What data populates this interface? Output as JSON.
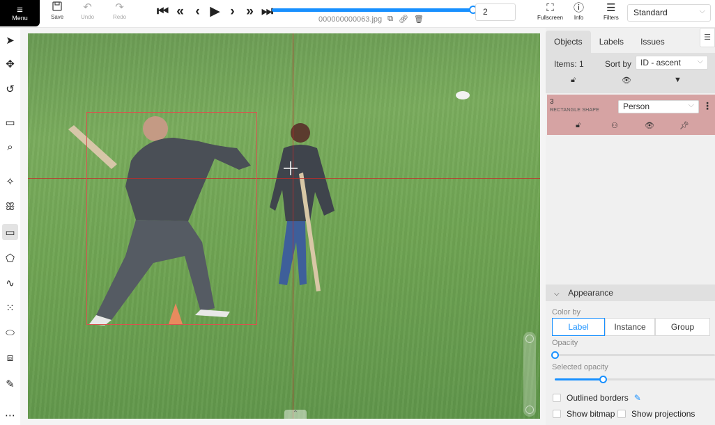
{
  "toolbar": {
    "menu_label": "Menu",
    "save_label": "Save",
    "undo_label": "Undo",
    "redo_label": "Redo",
    "frame_number": "2",
    "filename": "000000000063.jpg",
    "fullscreen_label": "Fullscreen",
    "info_label": "Info",
    "filters_label": "Filters",
    "workspace": "Standard"
  },
  "navigation": {
    "icons": [
      "first-frame-icon",
      "fast-backward-icon",
      "prev-frame-icon",
      "play-icon",
      "next-frame-icon",
      "fast-forward-icon",
      "last-frame-icon"
    ],
    "frame_slider_progress": 0.98
  },
  "left_tools": [
    "cursor-icon",
    "move-icon",
    "rotate-icon",
    "fit-image-icon",
    "zoom-region-icon",
    "magic-wand-icon",
    "opencv-icon",
    "rectangle-icon",
    "polygon-icon",
    "polyline-icon",
    "points-icon",
    "ellipse-icon",
    "cuboid-icon",
    "brush-icon",
    "more-icon"
  ],
  "side_panel": {
    "tabs": [
      "Objects",
      "Labels",
      "Issues"
    ],
    "active_tab": "Objects",
    "items_label": "Items: 1",
    "sort_label": "Sort by",
    "sort_value": "ID - ascent",
    "objects": [
      {
        "id": "3",
        "type": "RECTANGLE SHAPE",
        "label": "Person",
        "color": "#d6a3a3"
      }
    ]
  },
  "appearance": {
    "title": "Appearance",
    "color_by_label": "Color by",
    "color_by_options": [
      "Label",
      "Instance",
      "Group"
    ],
    "color_by_selected": "Label",
    "opacity_label": "Opacity",
    "opacity_value": 0,
    "selected_opacity_label": "Selected opacity",
    "selected_opacity_value": 0.3,
    "outlined_borders_label": "Outlined borders",
    "show_bitmap_label": "Show bitmap",
    "show_projections_label": "Show projections"
  },
  "colors": {
    "accent": "#1890ff",
    "annotation": "#d9534f"
  }
}
